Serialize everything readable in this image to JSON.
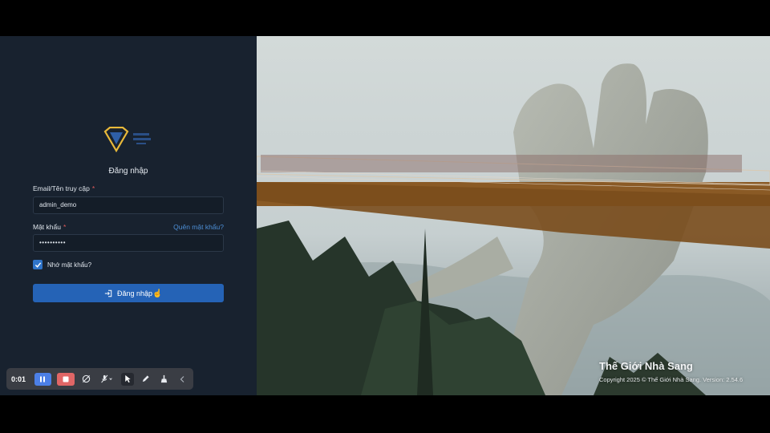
{
  "login": {
    "title": "Đăng nhập",
    "email_label": "Email/Tên truy cập",
    "email_value": "admin_demo",
    "password_label": "Mật khẩu",
    "password_value": "••••••••••",
    "required_mark": "*",
    "forgot_link": "Quên mật khẩu?",
    "remember_label": "Nhớ mật khẩu?",
    "remember_checked": true,
    "submit_label": "Đăng nhập"
  },
  "recorder": {
    "time": "0:01",
    "icons": [
      "pause-icon",
      "stop-icon",
      "camera-off-icon",
      "mic-off-icon",
      "pointer-icon",
      "pen-icon",
      "broom-icon",
      "chevron-left-icon"
    ]
  },
  "hero": {
    "brand": "Thế Giới Nhà Sang",
    "copyright": "Copyright 2025 © Thế Giới Nhà Sang. Version: 2.54.6"
  },
  "colors": {
    "panel_bg": "#18222f",
    "accent": "#2563b6",
    "link": "#4d8fd6",
    "required": "#e05a5a",
    "logo_gold": "#e8b93a"
  }
}
